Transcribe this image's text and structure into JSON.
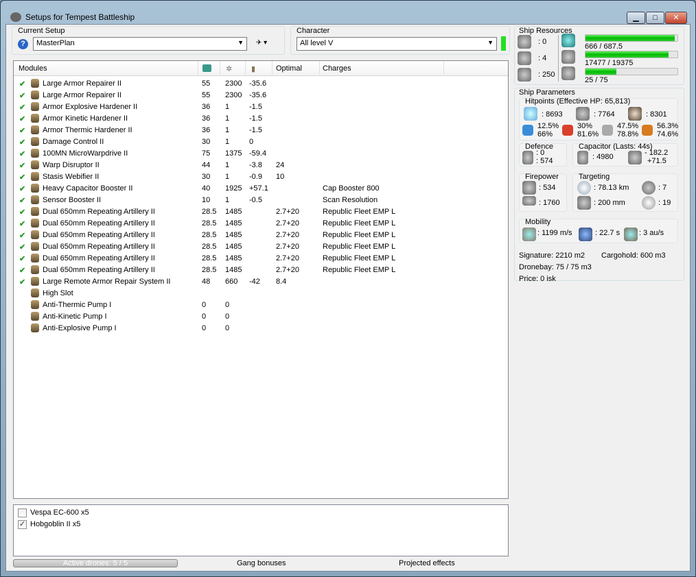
{
  "window": {
    "title": "Setups for Tempest Battleship",
    "min": "▁",
    "max": "□",
    "close": "✕"
  },
  "setup": {
    "label": "Current Setup",
    "value": "MasterPlan",
    "help": "?"
  },
  "character": {
    "label": "Character",
    "value": "All level V"
  },
  "columns": [
    "Modules",
    "cpu-icon",
    "powergrid-icon",
    "capacitor-icon",
    "Optimal",
    "Charges"
  ],
  "modules": [
    {
      "name": "Large Armor Repairer II",
      "cpu": "55",
      "pg": "2300",
      "cap": "-35.6",
      "opt": "",
      "charge": "",
      "on": true
    },
    {
      "name": "Large Armor Repairer II",
      "cpu": "55",
      "pg": "2300",
      "cap": "-35.6",
      "opt": "",
      "charge": "",
      "on": true
    },
    {
      "name": "Armor Explosive Hardener II",
      "cpu": "36",
      "pg": "1",
      "cap": "-1.5",
      "opt": "",
      "charge": "",
      "on": true
    },
    {
      "name": "Armor Kinetic Hardener II",
      "cpu": "36",
      "pg": "1",
      "cap": "-1.5",
      "opt": "",
      "charge": "",
      "on": true
    },
    {
      "name": "Armor Thermic Hardener II",
      "cpu": "36",
      "pg": "1",
      "cap": "-1.5",
      "opt": "",
      "charge": "",
      "on": true
    },
    {
      "name": "Damage Control II",
      "cpu": "30",
      "pg": "1",
      "cap": "0",
      "opt": "",
      "charge": "",
      "on": true
    },
    {
      "name": "100MN MicroWarpdrive II",
      "cpu": "75",
      "pg": "1375",
      "cap": "-59.4",
      "opt": "",
      "charge": "",
      "on": true
    },
    {
      "name": "Warp Disruptor II",
      "cpu": "44",
      "pg": "1",
      "cap": "-3.8",
      "opt": "24",
      "charge": "",
      "on": true
    },
    {
      "name": "Stasis Webifier II",
      "cpu": "30",
      "pg": "1",
      "cap": "-0.9",
      "opt": "10",
      "charge": "",
      "on": true
    },
    {
      "name": "Heavy Capacitor Booster II",
      "cpu": "40",
      "pg": "1925",
      "cap": "+57.1",
      "opt": "",
      "charge": "Cap Booster 800",
      "on": true
    },
    {
      "name": "Sensor Booster II",
      "cpu": "10",
      "pg": "1",
      "cap": "-0.5",
      "opt": "",
      "charge": "Scan Resolution",
      "on": true
    },
    {
      "name": "Dual 650mm Repeating Artillery II",
      "cpu": "28.5",
      "pg": "1485",
      "cap": "",
      "opt": "2.7+20",
      "charge": "Republic Fleet EMP L",
      "on": true
    },
    {
      "name": "Dual 650mm Repeating Artillery II",
      "cpu": "28.5",
      "pg": "1485",
      "cap": "",
      "opt": "2.7+20",
      "charge": "Republic Fleet EMP L",
      "on": true
    },
    {
      "name": "Dual 650mm Repeating Artillery II",
      "cpu": "28.5",
      "pg": "1485",
      "cap": "",
      "opt": "2.7+20",
      "charge": "Republic Fleet EMP L",
      "on": true
    },
    {
      "name": "Dual 650mm Repeating Artillery II",
      "cpu": "28.5",
      "pg": "1485",
      "cap": "",
      "opt": "2.7+20",
      "charge": "Republic Fleet EMP L",
      "on": true
    },
    {
      "name": "Dual 650mm Repeating Artillery II",
      "cpu": "28.5",
      "pg": "1485",
      "cap": "",
      "opt": "2.7+20",
      "charge": "Republic Fleet EMP L",
      "on": true
    },
    {
      "name": "Dual 650mm Repeating Artillery II",
      "cpu": "28.5",
      "pg": "1485",
      "cap": "",
      "opt": "2.7+20",
      "charge": "Republic Fleet EMP L",
      "on": true
    },
    {
      "name": "Large Remote Armor Repair System II",
      "cpu": "48",
      "pg": "660",
      "cap": "-42",
      "opt": "8.4",
      "charge": "",
      "on": true
    },
    {
      "name": "High Slot",
      "cpu": "",
      "pg": "",
      "cap": "",
      "opt": "",
      "charge": "",
      "on": false
    },
    {
      "name": "Anti-Thermic Pump I",
      "cpu": "0",
      "pg": "0",
      "cap": "",
      "opt": "",
      "charge": "",
      "on": false
    },
    {
      "name": "Anti-Kinetic Pump I",
      "cpu": "0",
      "pg": "0",
      "cap": "",
      "opt": "",
      "charge": "",
      "on": false
    },
    {
      "name": "Anti-Explosive Pump I",
      "cpu": "0",
      "pg": "0",
      "cap": "",
      "opt": "",
      "charge": "",
      "on": false
    }
  ],
  "drones": [
    {
      "name": "Vespa EC-600 x5",
      "checked": false
    },
    {
      "name": "Hobgoblin II x5",
      "checked": true
    }
  ],
  "bottom": {
    "active_drones": "Active drones: 5 / 5",
    "gang": "Gang bonuses",
    "projected": "Projected effects"
  },
  "resources": {
    "label": "Ship Resources",
    "turrets": ": 0",
    "launchers": ": 4",
    "calibration": ": 250",
    "cpu": {
      "text": "666 / 687.5",
      "fill": 0.969
    },
    "pg": {
      "text": "17477 / 19375",
      "fill": 0.902
    },
    "drone": {
      "text": "25 / 75",
      "fill": 0.333
    }
  },
  "params": {
    "label": "Ship Parameters",
    "hp_label": "Hitpoints (Effective HP: 65,813)",
    "shield": ": 8693",
    "armor": ": 7764",
    "hull": ": 8301",
    "resists": [
      [
        "12.5%",
        "66%"
      ],
      [
        "30%",
        "81.6%"
      ],
      [
        "47.5%",
        "78.8%"
      ],
      [
        "56.3%",
        "74.6%"
      ]
    ],
    "defence_label": "Defence",
    "def1": ": 0",
    "def2": ": 574",
    "cap_label": "Capacitor (Lasts: 44s)",
    "cap": ": 4980",
    "cap_use": "- 182.2",
    "cap_rec": "+71.5",
    "fire_label": "Firepower",
    "dps": ": 534",
    "volley": ": 1760",
    "target_label": "Targeting",
    "range": ": 78.13 km",
    "maxtargets": ": 7",
    "scanres": ": 200 mm",
    "sensor": ": 19",
    "mob_label": "Mobility",
    "speed": ": 1199 m/s",
    "align": ": 22.7 s",
    "warp": ": 3 au/s",
    "signature": "Signature: 2210 m2",
    "cargo": "Cargohold: 600 m3",
    "dronebay": "Dronebay: 75 / 75 m3",
    "price": "Price: 0 isk"
  }
}
